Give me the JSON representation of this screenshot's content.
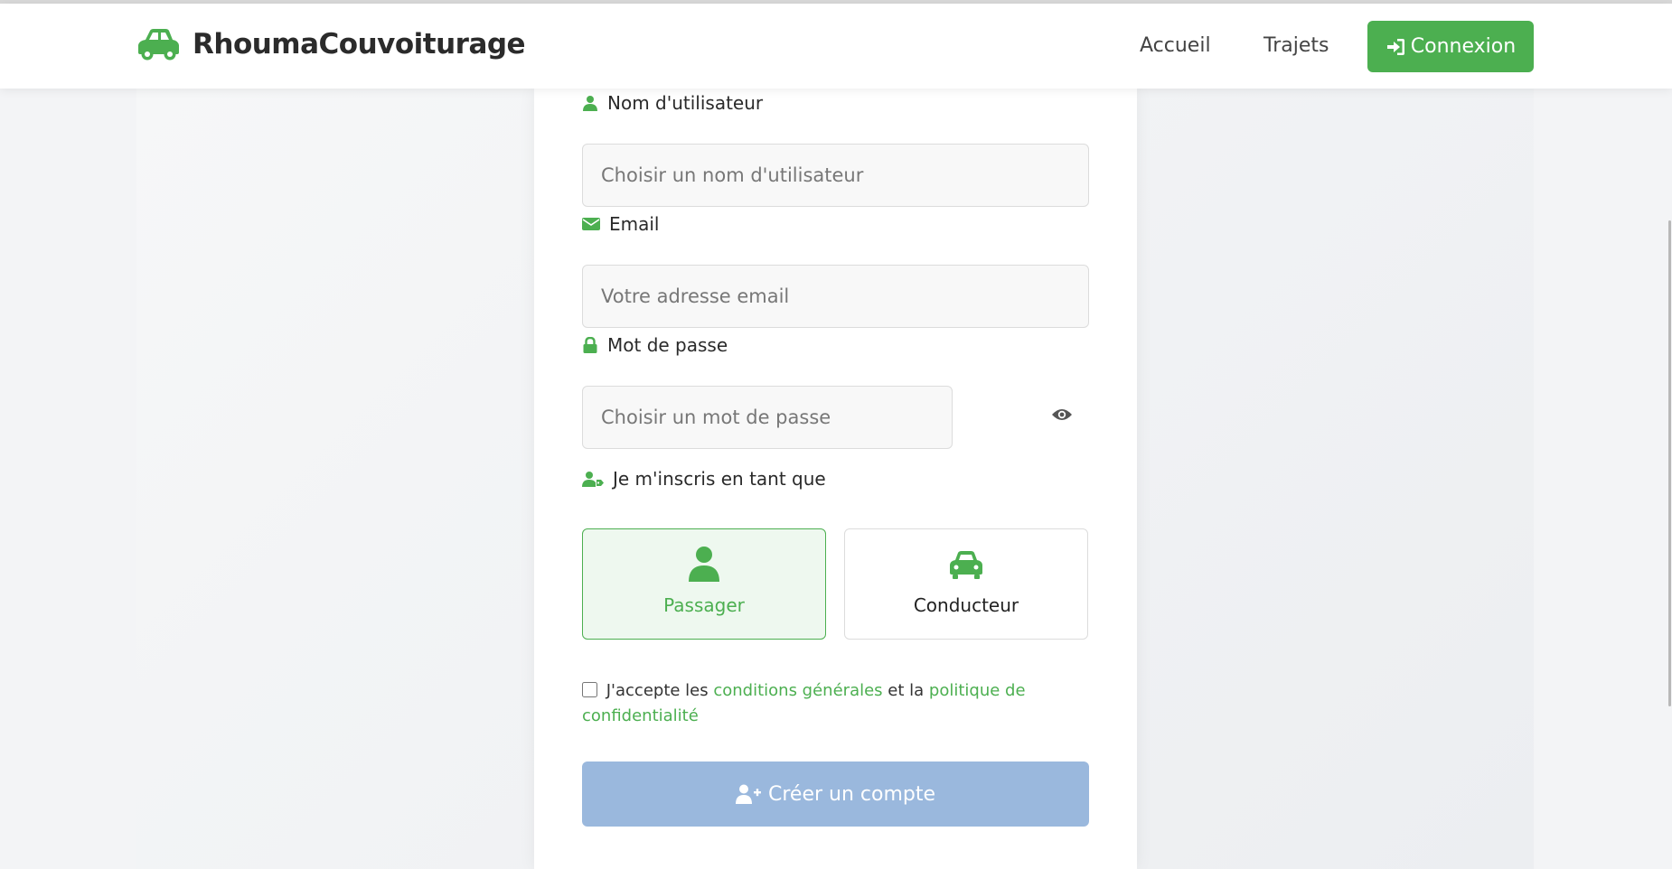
{
  "brand": {
    "name": "RhoumaCouvoiturage",
    "icon": "car-icon"
  },
  "nav": {
    "accueil": "Accueil",
    "trajets": "Trajets",
    "connexion": "Connexion"
  },
  "form": {
    "username": {
      "label": "Nom d'utilisateur",
      "placeholder": "Choisir un nom d'utilisateur",
      "value": ""
    },
    "email": {
      "label": "Email",
      "placeholder": "Votre adresse email",
      "value": ""
    },
    "password": {
      "label": "Mot de passe",
      "placeholder": "Choisir un mot de passe",
      "value": ""
    },
    "role": {
      "label": "Je m'inscris en tant que",
      "passager": "Passager",
      "conducteur": "Conducteur",
      "selected": "Passager"
    },
    "terms": {
      "prefix": "J'accepte les",
      "conditions": "conditions générales",
      "middle": "et la",
      "politique": "politique de confidentialité",
      "checked": false
    },
    "submit": "Créer un compte"
  },
  "colors": {
    "accent": "#4caf50",
    "submit_disabled": "#9ab8dd",
    "text": "#2a2a2a"
  }
}
